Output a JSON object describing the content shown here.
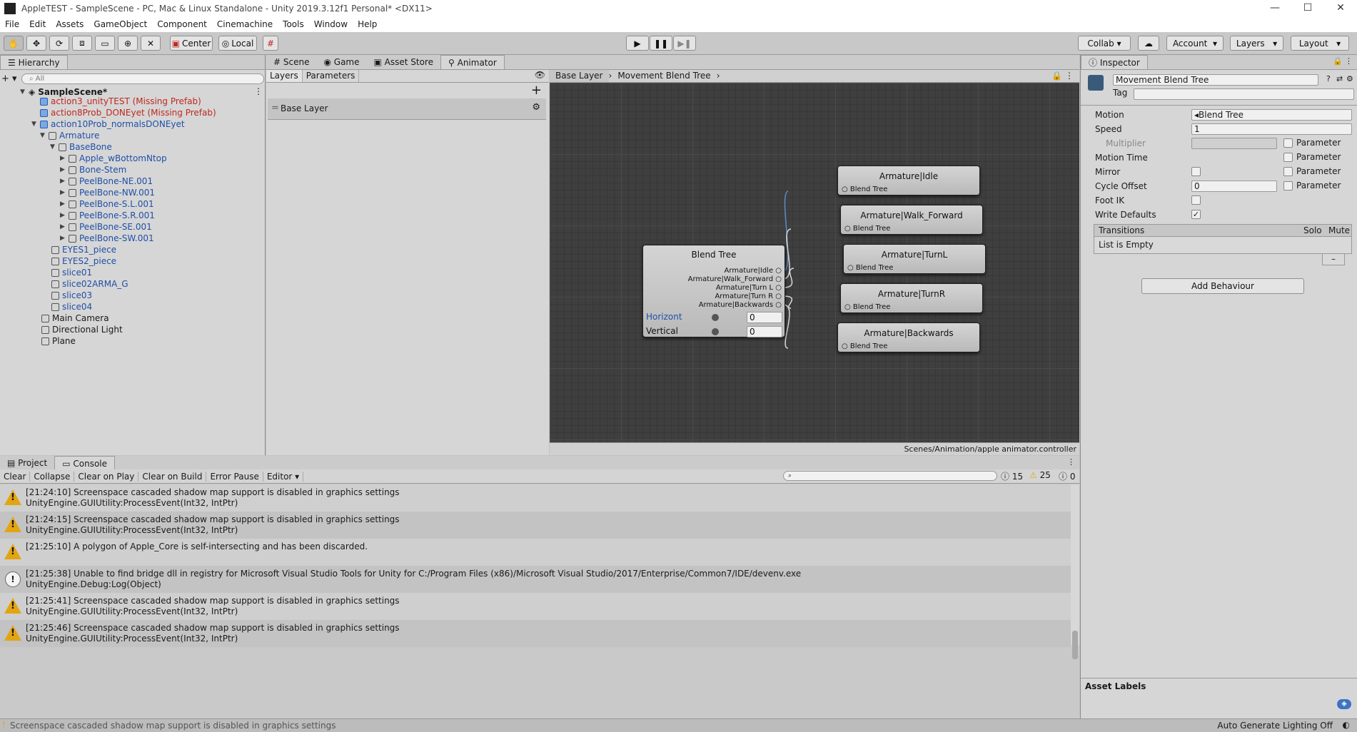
{
  "window": {
    "title": "AppleTEST - SampleScene - PC, Mac & Linux Standalone - Unity 2019.3.12f1 Personal* <DX11>",
    "minimize": "—",
    "maximize": "☐",
    "close": "✕"
  },
  "menu": [
    "File",
    "Edit",
    "Assets",
    "GameObject",
    "Component",
    "Cinemachine",
    "Tools",
    "Window",
    "Help"
  ],
  "toolbar": {
    "center_label": "Center",
    "local_label": "Local",
    "collab_label": "Collab",
    "account_label": "Account",
    "layers_label": "Layers",
    "layout_label": "Layout"
  },
  "hierarchy": {
    "tab_label": "Hierarchy",
    "search_placeholder": "All",
    "scene_name": "SampleScene*",
    "items": [
      {
        "label": "action3_unityTEST (Missing Prefab)"
      },
      {
        "label": "action8Prob_DONEyet (Missing Prefab)"
      },
      {
        "label": "action10Prob_normalsDONEyet"
      },
      {
        "label": "Armature"
      },
      {
        "label": "BaseBone"
      },
      {
        "label": "Apple_wBottomNtop"
      },
      {
        "label": "Bone-Stem"
      },
      {
        "label": "PeelBone-NE.001"
      },
      {
        "label": "PeelBone-NW.001"
      },
      {
        "label": "PeelBone-S.L.001"
      },
      {
        "label": "PeelBone-S.R.001"
      },
      {
        "label": "PeelBone-SE.001"
      },
      {
        "label": "PeelBone-SW.001"
      },
      {
        "label": "EYES1_piece"
      },
      {
        "label": "EYES2_piece"
      },
      {
        "label": "slice01"
      },
      {
        "label": "slice02ARMA_G"
      },
      {
        "label": "slice03"
      },
      {
        "label": "slice04"
      },
      {
        "label": "Main Camera"
      },
      {
        "label": "Directional Light"
      },
      {
        "label": "Plane"
      }
    ]
  },
  "center_tabs": {
    "scene": "Scene",
    "game": "Game",
    "asset_store": "Asset Store",
    "animator": "Animator"
  },
  "animator": {
    "layers_tab": "Layers",
    "parameters_tab": "Parameters",
    "base_layer": "Base Layer",
    "breadcrumb_1": "Base Layer",
    "breadcrumb_2": "Movement Blend Tree",
    "controller_path": "Scenes/Animation/apple animator.controller",
    "blend_tree": {
      "title": "Blend Tree",
      "outputs": [
        "Armature|Idle",
        "Armature|Walk_Forward",
        "Armature|Turn L",
        "Armature|Turn R",
        "Armature|Backwards"
      ],
      "param1_label": "Horizont",
      "param1_value": "0",
      "param2_label": "Vertical",
      "param2_value": "0"
    },
    "motion_nodes": [
      {
        "title": "Armature|Idle",
        "sub": "Blend Tree"
      },
      {
        "title": "Armature|Walk_Forward",
        "sub": "Blend Tree"
      },
      {
        "title": "Armature|TurnL",
        "sub": "Blend Tree"
      },
      {
        "title": "Armature|TurnR",
        "sub": "Blend Tree"
      },
      {
        "title": "Armature|Backwards",
        "sub": "Blend Tree"
      }
    ]
  },
  "inspector": {
    "tab_label": "Inspector",
    "object_name": "Movement Blend Tree",
    "tag_label": "Tag",
    "motion_label": "Motion",
    "motion_value": "Blend Tree",
    "speed_label": "Speed",
    "speed_value": "1",
    "multiplier_label": "Multiplier",
    "motion_time_label": "Motion Time",
    "mirror_label": "Mirror",
    "cycle_offset_label": "Cycle Offset",
    "cycle_offset_value": "0",
    "foot_ik_label": "Foot IK",
    "write_defaults_label": "Write Defaults",
    "parameter_label": "Parameter",
    "transitions_label": "Transitions",
    "solo_label": "Solo",
    "mute_label": "Mute",
    "list_empty": "List is Empty",
    "add_behaviour": "Add Behaviour",
    "asset_labels": "Asset Labels"
  },
  "console": {
    "project_tab": "Project",
    "console_tab": "Console",
    "clear": "Clear",
    "collapse": "Collapse",
    "clear_on_play": "Clear on Play",
    "clear_on_build": "Clear on Build",
    "error_pause": "Error Pause",
    "editor": "Editor",
    "info_count": "15",
    "warn_count": "25",
    "error_count": "0",
    "logs": [
      {
        "type": "warning",
        "line1": "[21:24:10] Screenspace cascaded shadow map support is disabled in graphics settings",
        "line2": "UnityEngine.GUIUtility:ProcessEvent(Int32, IntPtr)"
      },
      {
        "type": "warning",
        "line1": "[21:24:15] Screenspace cascaded shadow map support is disabled in graphics settings",
        "line2": "UnityEngine.GUIUtility:ProcessEvent(Int32, IntPtr)"
      },
      {
        "type": "warning",
        "line1": "[21:25:10] A polygon of Apple_Core is self-intersecting and has been discarded.",
        "line2": ""
      },
      {
        "type": "info",
        "line1": "[21:25:38] Unable to find bridge dll in registry for Microsoft Visual Studio Tools for Unity for C:/Program Files (x86)/Microsoft Visual Studio/2017/Enterprise/Common7/IDE/devenv.exe",
        "line2": "UnityEngine.Debug:Log(Object)"
      },
      {
        "type": "warning",
        "line1": "[21:25:41] Screenspace cascaded shadow map support is disabled in graphics settings",
        "line2": "UnityEngine.GUIUtility:ProcessEvent(Int32, IntPtr)"
      },
      {
        "type": "warning",
        "line1": "[21:25:46] Screenspace cascaded shadow map support is disabled in graphics settings",
        "line2": "UnityEngine.GUIUtility:ProcessEvent(Int32, IntPtr)"
      }
    ]
  },
  "status": {
    "message": "Screenspace cascaded shadow map support is disabled in graphics settings",
    "lighting": "Auto Generate Lighting Off"
  },
  "colors": {
    "warning": "#e2a512",
    "link_blue": "#1f4fa8",
    "missing_red": "#c0271f",
    "graph_bg": "#3f3f3f"
  }
}
